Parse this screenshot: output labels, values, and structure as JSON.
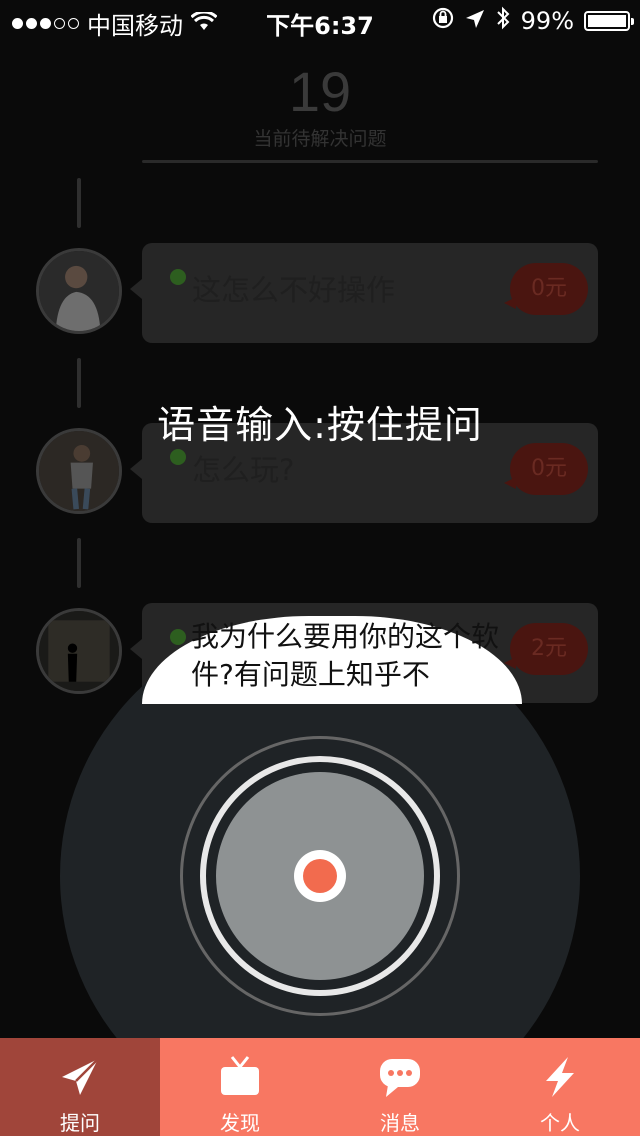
{
  "status_bar": {
    "carrier": "中国移动",
    "time": "下午6:37",
    "battery": "99%",
    "battery_level": 0.99,
    "signal_bars_filled": 3,
    "signal_bars_total": 5
  },
  "header": {
    "count": "19",
    "label": "当前待解决问题"
  },
  "questions": [
    {
      "text": "这怎么不好操作",
      "price": "0元"
    },
    {
      "text": "怎么玩?",
      "price": "0元"
    },
    {
      "text": "我为什么要用你的这个软件?有问题上知乎不",
      "price": "2元"
    }
  ],
  "overlay_hint": "语音输入:按住提问",
  "record_button": {
    "icon": "record-icon"
  },
  "tabs": [
    {
      "label": "提问",
      "icon": "paper-plane-icon",
      "active": true
    },
    {
      "label": "发现",
      "icon": "tv-icon",
      "active": false
    },
    {
      "label": "消息",
      "icon": "chat-bubble-icon",
      "active": false
    },
    {
      "label": "个人",
      "icon": "lightning-icon",
      "active": false
    }
  ],
  "colors": {
    "accent": "#f87762",
    "tab_active": "#a0453a",
    "record": "#f26b4e"
  }
}
